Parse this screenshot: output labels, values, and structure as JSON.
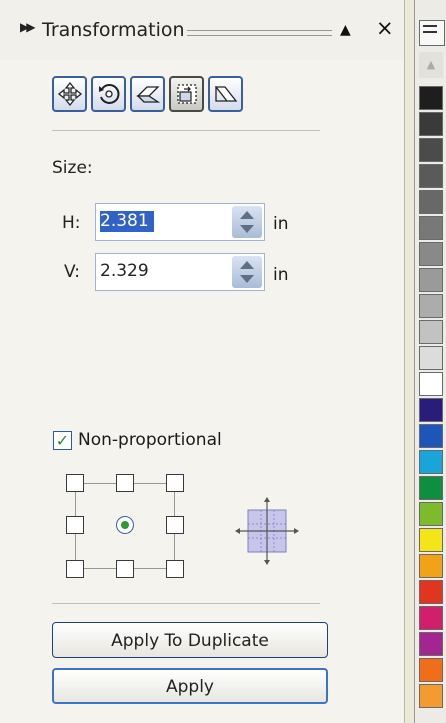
{
  "docker": {
    "title": "Transformation",
    "title_icon": "double-chevron-right-icon",
    "minimize_icon": "triangle-up-icon",
    "close_label": "×"
  },
  "toolbar": {
    "buttons": [
      {
        "name": "position",
        "icon": "move-arrows-icon",
        "active": false
      },
      {
        "name": "rotate",
        "icon": "rotate-icon",
        "active": false
      },
      {
        "name": "scale-mirror",
        "icon": "scale-mirror-icon",
        "active": false
      },
      {
        "name": "size",
        "icon": "size-icon",
        "active": true
      },
      {
        "name": "skew",
        "icon": "skew-icon",
        "active": false
      }
    ]
  },
  "size": {
    "section_label": "Size:",
    "h_label": "H:",
    "h_value": "2.381",
    "v_label": "V:",
    "v_value": "2.329",
    "unit": "in"
  },
  "non_proportional": {
    "label": "Non-proportional",
    "checked": true
  },
  "anchor": {
    "selected": "center"
  },
  "buttons": {
    "apply_duplicate": "Apply To Duplicate",
    "apply": "Apply"
  },
  "palette": {
    "swatches": [
      "#1e1e1e",
      "#3a3a3a",
      "#4b4b4b",
      "#5a5a5a",
      "#686868",
      "#787878",
      "#898989",
      "#9a9a9a",
      "#acacac",
      "#c2c2c2",
      "#dcdcdc",
      "#ffffff",
      "#2a1c7a",
      "#1d56b8",
      "#1aa5d8",
      "#0e8f3f",
      "#7dbb2d",
      "#f4e51a",
      "#f0a316",
      "#e0351e",
      "#d21f6c",
      "#a3258f",
      "#f06e1a",
      "#f39b2e"
    ]
  }
}
